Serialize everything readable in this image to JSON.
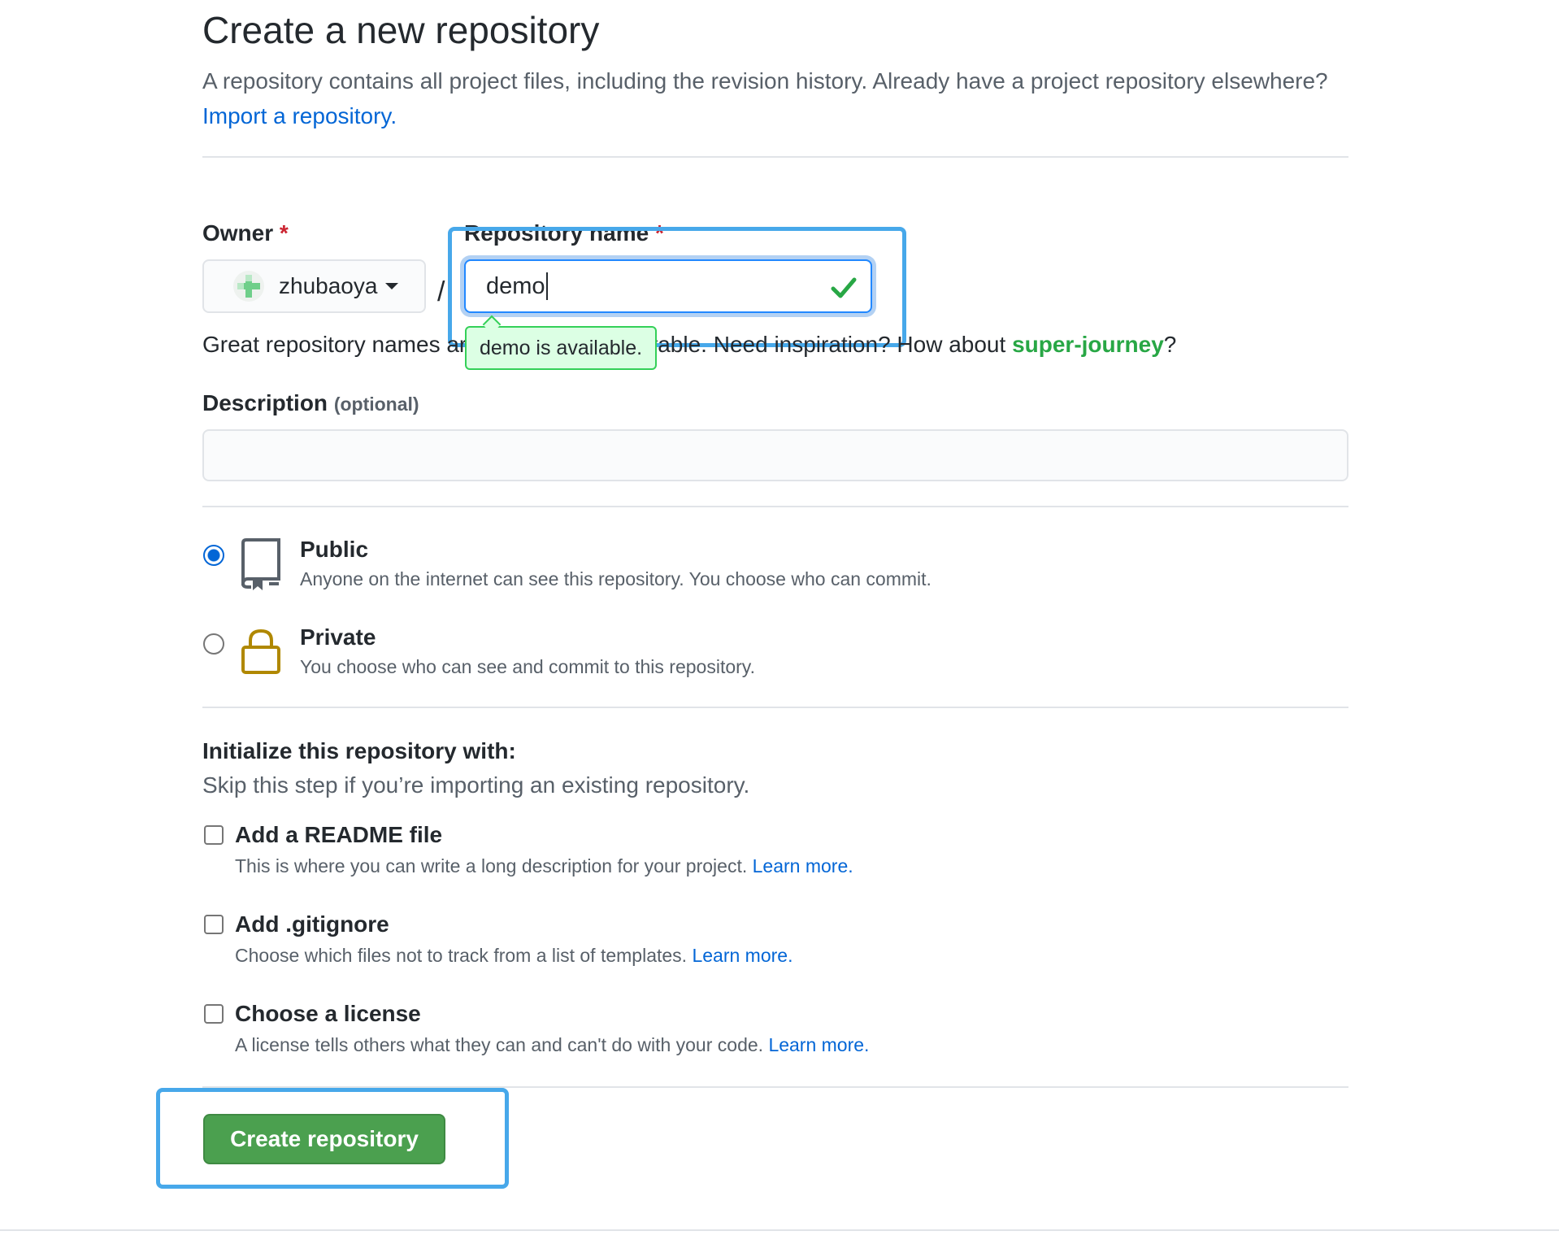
{
  "page": {
    "title": "Create a new repository",
    "subtitle": "A repository contains all project files, including the revision history. Already have a project repository elsewhere?",
    "import_link": "Import a repository."
  },
  "owner": {
    "label": "Owner",
    "required_mark": "*",
    "value": "zhubaoya"
  },
  "separator": "/",
  "repo_name": {
    "label": "Repository name",
    "required_mark": "*",
    "value": "demo",
    "availability": "demo is available."
  },
  "name_hint": {
    "text_before": "Great repository names are short and memorable. Need inspiration? How about ",
    "suggestion": "super-journey",
    "text_after": "?"
  },
  "description": {
    "label": "Description",
    "optional": "(optional)",
    "value": ""
  },
  "visibility": {
    "selected": "Public",
    "public": {
      "title": "Public",
      "desc": "Anyone on the internet can see this repository. You choose who can commit."
    },
    "private": {
      "title": "Private",
      "desc": "You choose who can see and commit to this repository."
    }
  },
  "init": {
    "title": "Initialize this repository with:",
    "subtitle": "Skip this step if you’re importing an existing repository.",
    "readme": {
      "title": "Add a README file",
      "desc": "This is where you can write a long description for your project.",
      "link": "Learn more."
    },
    "gitignore": {
      "title": "Add .gitignore",
      "desc": "Choose which files not to track from a list of templates.",
      "link": "Learn more."
    },
    "license": {
      "title": "Choose a license",
      "desc": "A license tells others what they can and can't do with your code.",
      "link": "Learn more."
    }
  },
  "submit": {
    "label": "Create repository"
  },
  "colors": {
    "link": "#0366d6",
    "success": "#28a745",
    "button": "#4ba04f",
    "annotation": "#47a8ea",
    "private_icon": "#b08800"
  }
}
